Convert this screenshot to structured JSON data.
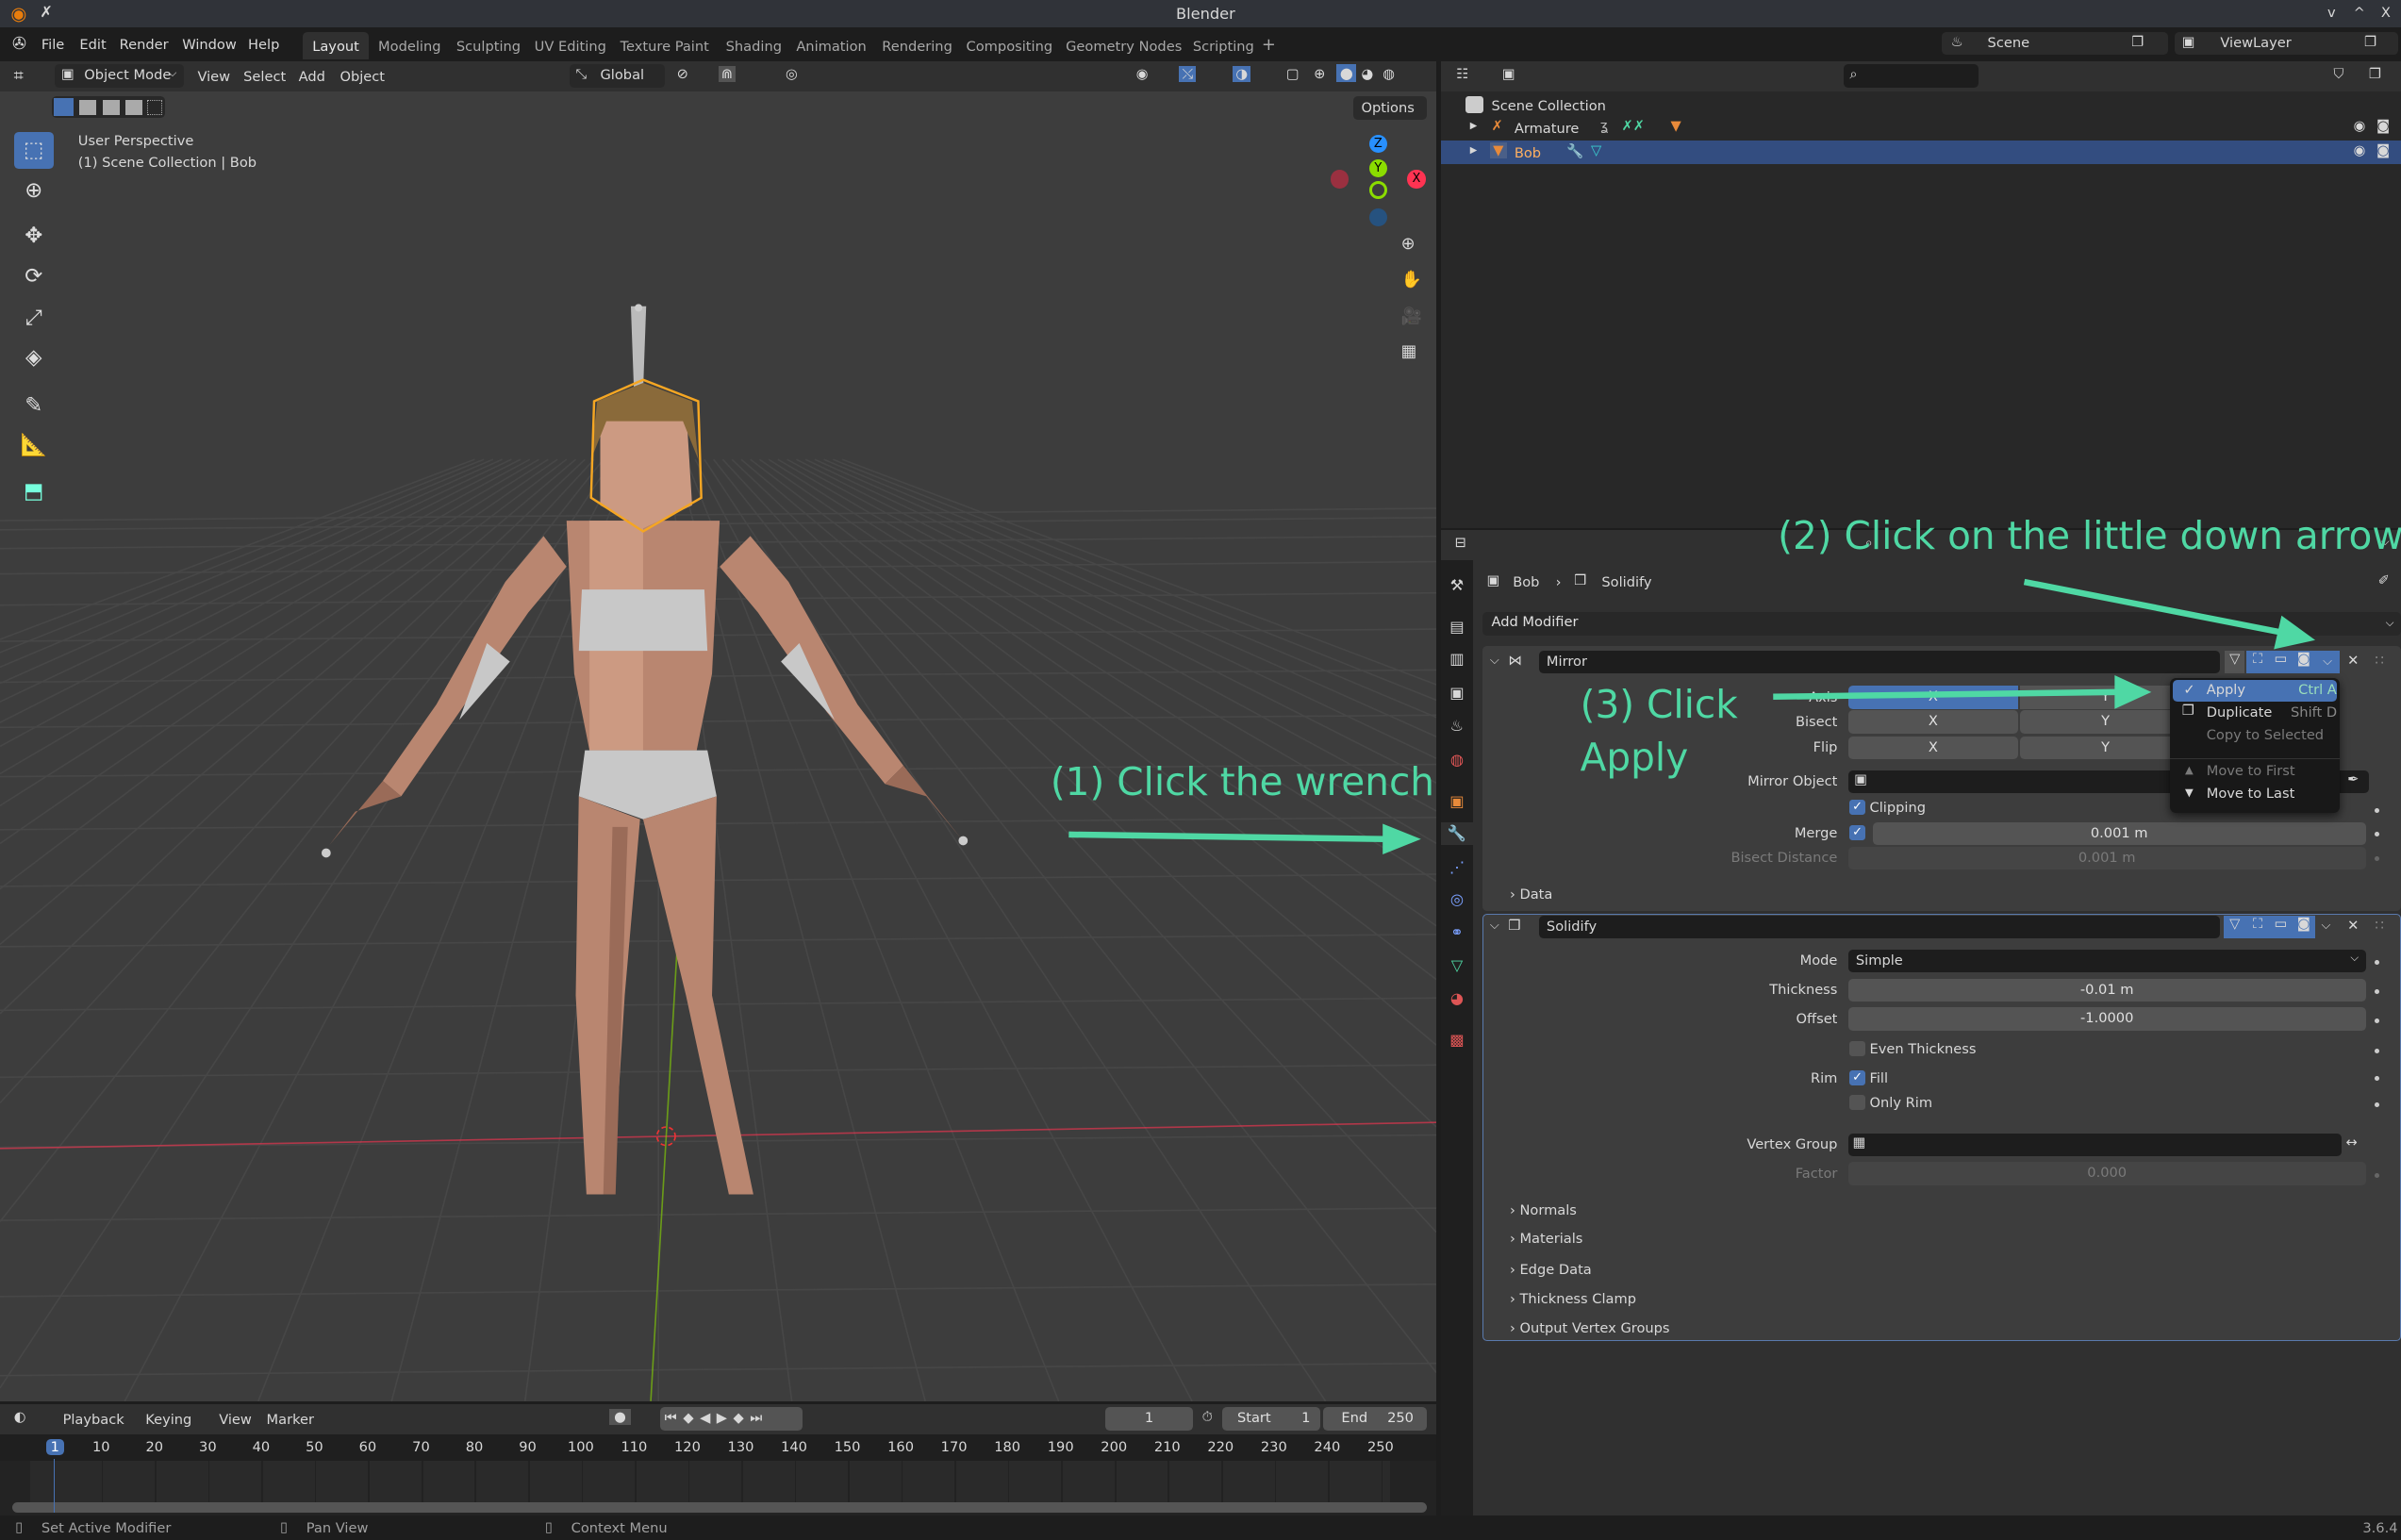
{
  "window": {
    "title": "Blender",
    "controls": [
      "v",
      "^",
      "X"
    ]
  },
  "menubar": {
    "items": [
      "File",
      "Edit",
      "Render",
      "Window",
      "Help"
    ],
    "workspaces": [
      "Layout",
      "Modeling",
      "Sculpting",
      "UV Editing",
      "Texture Paint",
      "Shading",
      "Animation",
      "Rendering",
      "Compositing",
      "Geometry Nodes",
      "Scripting"
    ],
    "active_workspace": "Layout",
    "add_tab": "+",
    "scene": "Scene",
    "view_layer": "ViewLayer"
  },
  "viewport": {
    "mode": "Object Mode",
    "menus": [
      "View",
      "Select",
      "Add",
      "Object"
    ],
    "transform_orientation": "Global",
    "options_label": "Options",
    "overlay_line1": "User Perspective",
    "overlay_line2": "(1) Scene Collection | Bob",
    "gizmo": {
      "z": "Z",
      "y": "Y",
      "x": "X"
    },
    "axis_colors": {
      "x": "#ff3352",
      "y": "#8bdc00",
      "z": "#2890ff"
    }
  },
  "outliner": {
    "root": "Scene Collection",
    "items": [
      {
        "name": "Armature",
        "selected": false
      },
      {
        "name": "Bob",
        "selected": true
      }
    ]
  },
  "properties": {
    "breadcrumb": [
      "Bob",
      "Solidify"
    ],
    "add_modifier": "Add Modifier",
    "mirror": {
      "name": "Mirror",
      "rows": [
        {
          "label": "Axis",
          "values": [
            "X",
            "Y"
          ],
          "active": 0
        },
        {
          "label": "Bisect",
          "values": [
            "X",
            "Y"
          ]
        },
        {
          "label": "Flip",
          "values": [
            "X",
            "Y"
          ]
        }
      ],
      "mirror_object_label": "Mirror Object",
      "clipping_label": "Clipping",
      "clipping": true,
      "merge_label": "Merge",
      "merge": true,
      "merge_value": "0.001 m",
      "bisect_distance_label": "Bisect Distance",
      "bisect_distance": "0.001 m",
      "data_subpanel": "Data"
    },
    "solidify": {
      "name": "Solidify",
      "mode_label": "Mode",
      "mode": "Simple",
      "thickness_label": "Thickness",
      "thickness": "-0.01 m",
      "offset_label": "Offset",
      "offset": "-1.0000",
      "even_thickness_label": "Even Thickness",
      "even_thickness": false,
      "rim_label": "Rim",
      "fill_label": "Fill",
      "fill": true,
      "only_rim_label": "Only Rim",
      "only_rim": false,
      "vertex_group_label": "Vertex Group",
      "factor_label": "Factor",
      "factor": "0.000",
      "subpanels": [
        "Normals",
        "Materials",
        "Edge Data",
        "Thickness Clamp",
        "Output Vertex Groups"
      ]
    },
    "dropdown_menu": [
      {
        "label": "Apply",
        "shortcut": "Ctrl A",
        "highlighted": true
      },
      {
        "label": "Duplicate",
        "shortcut": "Shift D"
      },
      {
        "label": "Copy to Selected",
        "disabled": true
      },
      {
        "label": "Move to First",
        "disabled": true
      },
      {
        "label": "Move to Last"
      }
    ]
  },
  "annotations": {
    "step1": "(1) Click the wrench",
    "step2": "(2) Click on the little down arrow",
    "step3_line1": "(3) Click",
    "step3_line2": "Apply",
    "color": "#4fd8a4"
  },
  "timeline": {
    "menus": [
      "Playback",
      "Keying",
      "View",
      "Marker"
    ],
    "current_frame": "1",
    "start_label": "Start",
    "start": "1",
    "end_label": "End",
    "end": "250",
    "ruler": [
      "1",
      "10",
      "20",
      "30",
      "40",
      "50",
      "60",
      "70",
      "80",
      "90",
      "100",
      "110",
      "120",
      "130",
      "140",
      "150",
      "160",
      "170",
      "180",
      "190",
      "200",
      "210",
      "220",
      "230",
      "240",
      "250"
    ]
  },
  "statusbar": {
    "left": "Set Active Modifier",
    "middle": "Pan View",
    "right": "Context Menu",
    "version": "3.6.4"
  }
}
